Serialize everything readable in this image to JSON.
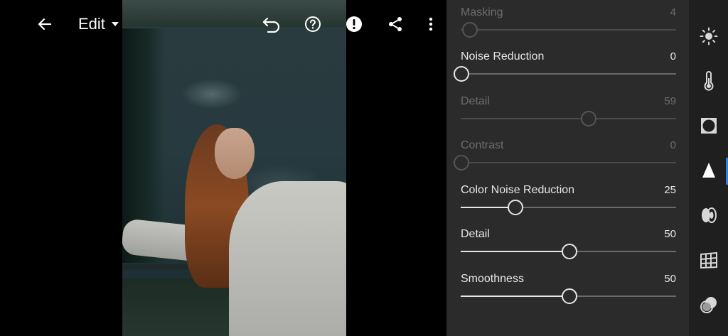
{
  "toolbar": {
    "back_icon": "arrow-left-icon",
    "mode_label": "Edit",
    "mode_icon": "caret-down-icon",
    "undo_icon": "undo-icon",
    "help_icon": "help-circle-icon",
    "alert_icon": "alert-circle-icon",
    "share_icon": "share-icon",
    "more_icon": "more-vertical-icon"
  },
  "panel": {
    "sliders": [
      {
        "label": "Masking",
        "value": "4",
        "level": 0.04,
        "enabled": false
      },
      {
        "label": "Noise Reduction",
        "value": "0",
        "level": 0.0,
        "enabled": true
      },
      {
        "label": "Detail",
        "value": "59",
        "level": 0.59,
        "enabled": false
      },
      {
        "label": "Contrast",
        "value": "0",
        "level": 0.0,
        "enabled": false
      },
      {
        "label": "Color Noise Reduction",
        "value": "25",
        "level": 0.25,
        "enabled": true
      },
      {
        "label": "Detail",
        "value": "50",
        "level": 0.5,
        "enabled": true
      },
      {
        "label": "Smoothness",
        "value": "50",
        "level": 0.5,
        "enabled": true
      }
    ]
  },
  "rail": {
    "items": [
      {
        "icon": "light-sun-icon"
      },
      {
        "icon": "color-thermometer-icon"
      },
      {
        "icon": "effects-vignette-icon"
      },
      {
        "icon": "detail-triangle-icon",
        "active": true
      },
      {
        "icon": "optics-lens-icon"
      },
      {
        "icon": "geometry-grid-icon"
      },
      {
        "icon": "presets-circles-icon"
      }
    ],
    "accent_color": "#2f7ee6"
  },
  "colors": {
    "panel_bg": "#2b2b2b",
    "rail_bg": "#1f1f1f",
    "text": "#e6e6e6",
    "disabled_text": "#6d6d6d"
  }
}
